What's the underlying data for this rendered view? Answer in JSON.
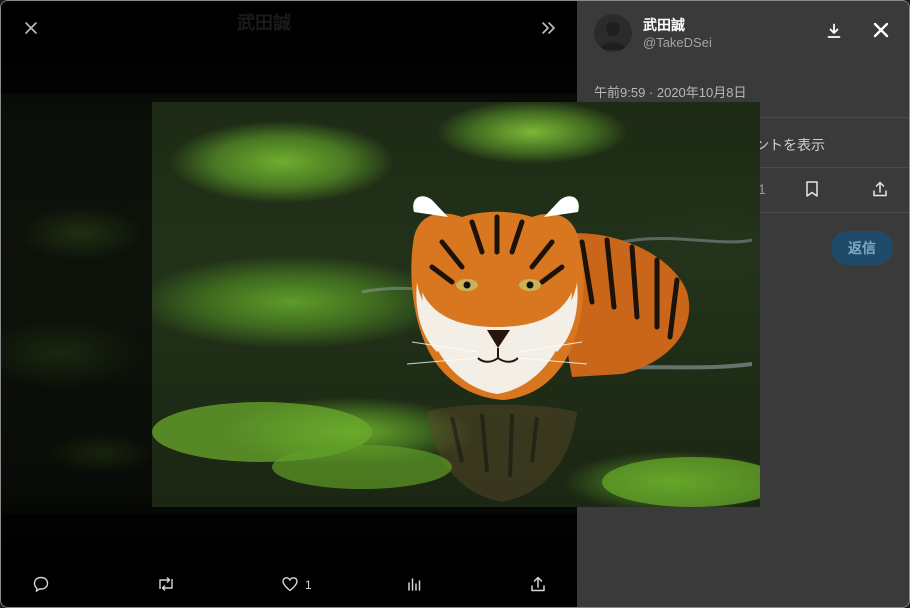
{
  "viewer": {
    "close_icon": "close-icon",
    "expand_icon": "double-chevron-right-icon",
    "ghost_name": "武田誠",
    "image": {
      "subject": "tiger swimming in green algae water",
      "colors": {
        "algae": "#6fae2e",
        "water": "#1d2a15",
        "fur": "#d8771f"
      }
    },
    "actions": {
      "reply_icon": "comment-icon",
      "retweet_icon": "retweet-icon",
      "like_icon": "heart-icon",
      "like_count": "1",
      "analytics_icon": "bar-chart-icon",
      "share_icon": "share-icon"
    }
  },
  "panel": {
    "author": {
      "display_name": "武田誠",
      "handle": "@TakeDSei"
    },
    "download_icon": "download-icon",
    "close_icon": "close-icon",
    "timestamp": "午前9:59 · 2020年10月8日",
    "show_more_text": "ントを表示",
    "partial_count": "1",
    "bookmark_icon": "bookmark-icon",
    "share_icon": "share-icon",
    "reply_button": "返信",
    "colors": {
      "panel_bg": "#3a3a3a",
      "reply_button_bg": "#1f4a6a"
    }
  }
}
